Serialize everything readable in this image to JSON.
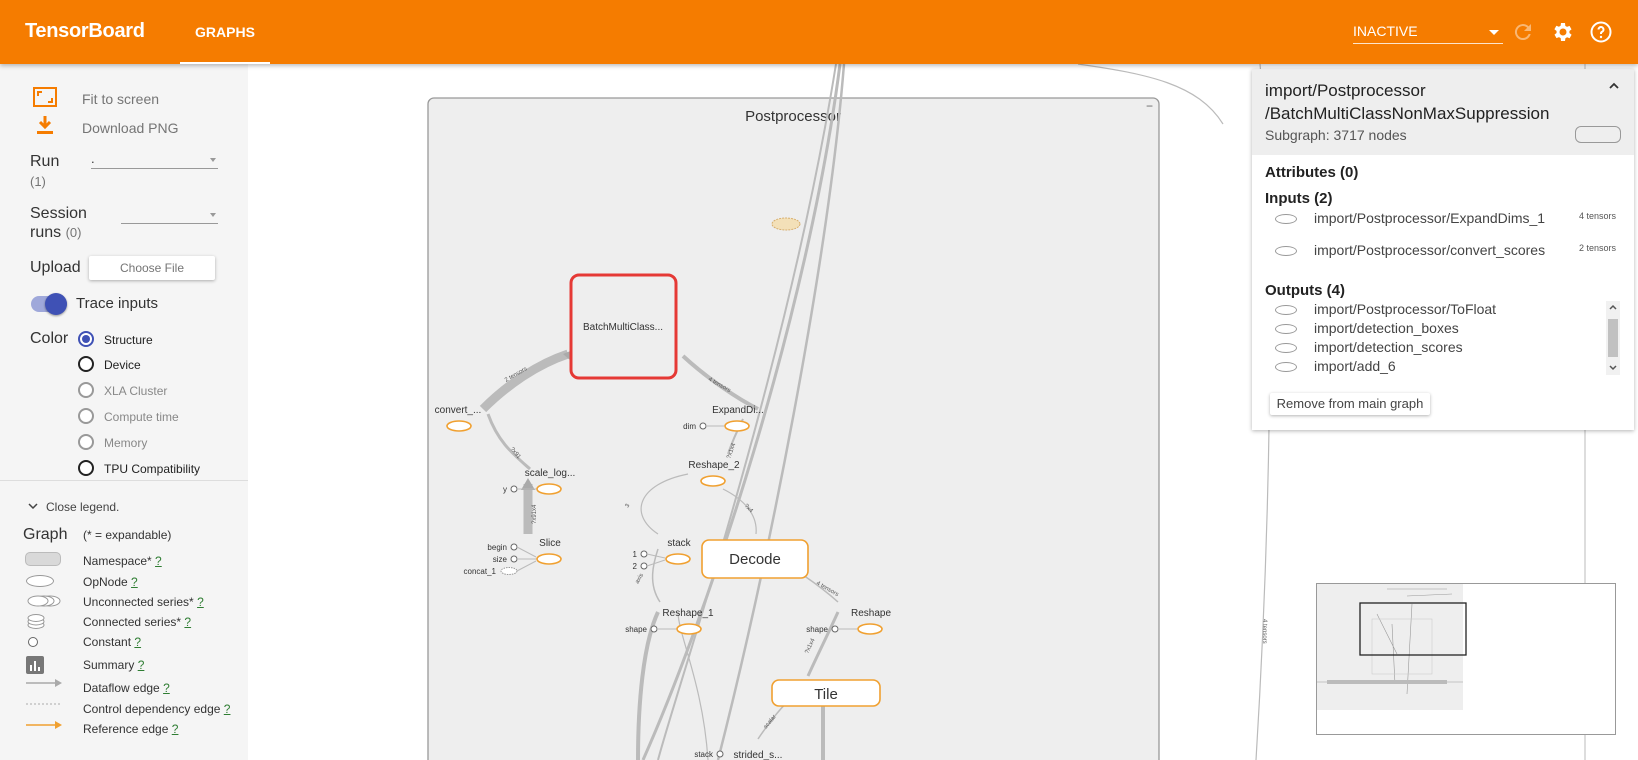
{
  "header": {
    "brand": "TensorBoard",
    "tab": "GRAPHS",
    "reload_state": "INACTIVE"
  },
  "sidebar": {
    "fit_to_screen": "Fit to screen",
    "download_png": "Download PNG",
    "run_label": "Run",
    "run_count": "(1)",
    "run_value": ".",
    "session_label_line1": "Session",
    "session_label_line2": "runs",
    "session_count": "(0)",
    "upload_label": "Upload",
    "choose_file": "Choose File",
    "trace_inputs": "Trace inputs",
    "color_label": "Color",
    "color_options": [
      {
        "label": "Structure",
        "checked": true,
        "enabled": true
      },
      {
        "label": "Device",
        "checked": false,
        "enabled": true
      },
      {
        "label": "XLA Cluster",
        "checked": false,
        "enabled": false
      },
      {
        "label": "Compute time",
        "checked": false,
        "enabled": false
      },
      {
        "label": "Memory",
        "checked": false,
        "enabled": false
      },
      {
        "label": "TPU Compatibility",
        "checked": false,
        "enabled": true
      }
    ]
  },
  "legend": {
    "close": "Close legend.",
    "graph": "Graph",
    "expandable": "(* = expandable)",
    "q": "?",
    "items": [
      "Namespace*",
      "OpNode",
      "Unconnected series*",
      "Connected series*",
      "Constant",
      "Summary",
      "Dataflow edge",
      "Control dependency edge",
      "Reference edge"
    ]
  },
  "graph": {
    "container_label": "Postprocessor",
    "nodes": {
      "batch": "BatchMultiClass...",
      "convert": "convert_...",
      "expand": "ExpandDi...",
      "dim": "dim",
      "reshape2": "Reshape_2",
      "scale": "scale_log...",
      "y": "y",
      "slice": "Slice",
      "begin": "begin",
      "size": "size",
      "concat": "concat_1",
      "stack": "stack",
      "one": "1",
      "two": "2",
      "decode": "Decode",
      "reshape1": "Reshape_1",
      "shape1": "shape",
      "reshape": "Reshape",
      "shape2": "shape",
      "tile": "Tile",
      "stack2": "stack",
      "strided": "strided_s..."
    },
    "edge_labels": {
      "two_tensors": "2 tensors",
      "four_tensors_a": "4 tensors",
      "four_tensors_b": "4 tensors",
      "three": "3",
      "axis": "axis",
      "scalar": "scalar",
      "dims_a": "?x1x4",
      "dims_b": "?x4",
      "dims_c": "?x91",
      "dims_d": "?x91x4",
      "dims_e": "?x1x4",
      "dims_f": "?x4"
    }
  },
  "info": {
    "title_line1": "import/Postprocessor",
    "title_line2": "/BatchMultiClassNonMaxSuppression",
    "subgraph": "Subgraph: 3717 nodes",
    "attributes": "Attributes (0)",
    "inputs": "Inputs (2)",
    "input_items": [
      {
        "name": "import/Postprocessor/ExpandDims_1",
        "tensors": "4 tensors"
      },
      {
        "name": "import/Postprocessor/convert_scores",
        "tensors": "2 tensors"
      }
    ],
    "outputs": "Outputs (4)",
    "output_items": [
      "import/Postprocessor/ToFloat",
      "import/detection_boxes",
      "import/detection_scores",
      "import/add_6"
    ],
    "remove": "Remove from main graph"
  },
  "colors": {
    "header": "#f57c00",
    "op_node": "#f0a030",
    "selected": "#e53935",
    "accent": "#3f51b5"
  }
}
